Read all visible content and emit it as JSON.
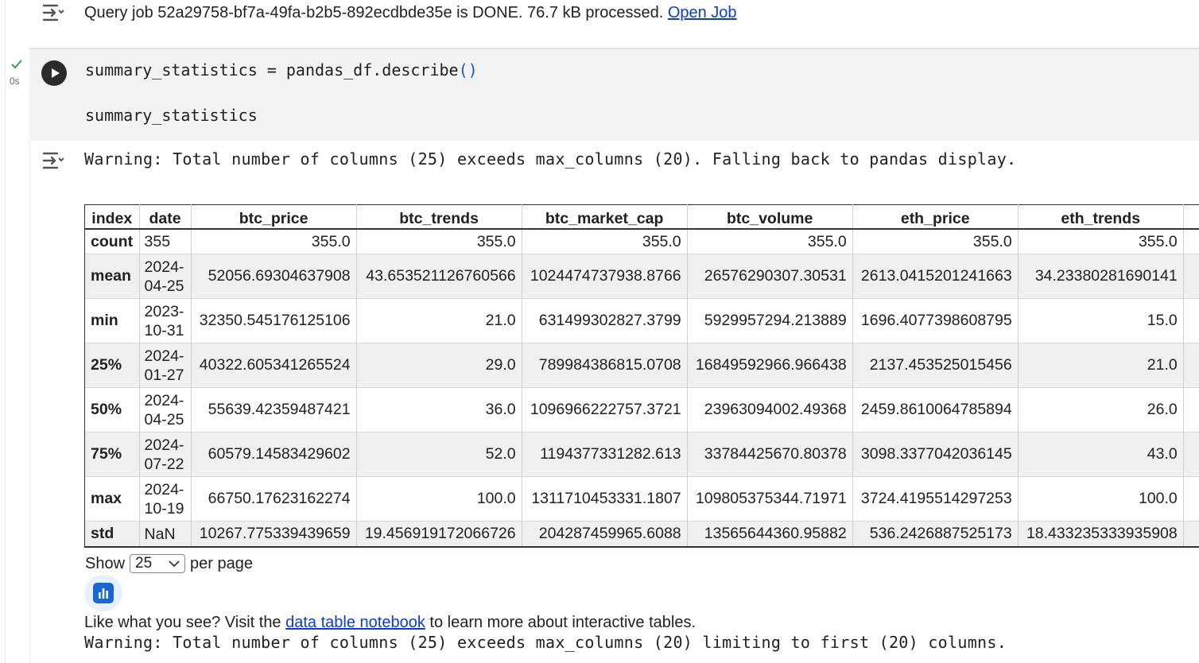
{
  "top_output": {
    "prefix": "Query job 52a29758-bf7a-49fa-b2b5-892ecdbde35e is DONE. 76.7 kB processed.",
    "link": "Open Job"
  },
  "cell": {
    "status": "check",
    "exec_time": "0s",
    "code_line1_main": "summary_statistics = pandas_df.describe",
    "code_line1_parens": "()",
    "code_line2": "summary_statistics"
  },
  "output": {
    "warning1": "Warning: Total number of columns (25) exceeds max_columns (20). Falling back to pandas display.",
    "warning2": "Warning: Total number of columns (25) exceeds max_columns (20) limiting to first (20) columns."
  },
  "table": {
    "columns": [
      "index",
      "date",
      "btc_price",
      "btc_trends",
      "btc_market_cap",
      "btc_volume",
      "eth_price",
      "eth_trends"
    ],
    "rows": [
      {
        "label": "count",
        "date_a": "355",
        "date_b": "",
        "values": [
          "355.0",
          "355.0",
          "355.0",
          "355.0",
          "355.0",
          "355.0"
        ]
      },
      {
        "label": "mean",
        "date_a": "2024-",
        "date_b": "04-25",
        "values": [
          "52056.69304637908",
          "43.653521126760566",
          "1024474737938.8766",
          "26576290307.30531",
          "2613.0415201241663",
          "34.23380281690141"
        ]
      },
      {
        "label": "min",
        "date_a": "2023-",
        "date_b": "10-31",
        "values": [
          "32350.545176125106",
          "21.0",
          "631499302827.3799",
          "5929957294.213889",
          "1696.4077398608795",
          "15.0"
        ]
      },
      {
        "label": "25%",
        "date_a": "2024-",
        "date_b": "01-27",
        "values": [
          "40322.605341265524",
          "29.0",
          "789984386815.0708",
          "16849592966.966438",
          "2137.453525015456",
          "21.0"
        ]
      },
      {
        "label": "50%",
        "date_a": "2024-",
        "date_b": "04-25",
        "values": [
          "55639.42359487421",
          "36.0",
          "1096966222757.3721",
          "23963094002.49368",
          "2459.8610064785894",
          "26.0"
        ]
      },
      {
        "label": "75%",
        "date_a": "2024-",
        "date_b": "07-22",
        "values": [
          "60579.14583429602",
          "52.0",
          "1194377331282.613",
          "33784425670.80378",
          "3098.3377042036145",
          "43.0"
        ]
      },
      {
        "label": "max",
        "date_a": "2024-",
        "date_b": "10-19",
        "values": [
          "66750.17623162274",
          "100.0",
          "1311710453331.1807",
          "109805375344.71971",
          "3724.4195514297253",
          "100.0"
        ]
      },
      {
        "label": "std",
        "date_a": "NaN",
        "date_b": "",
        "values": [
          "10267.775339439659",
          "19.456919172066726",
          "204287459965.6088",
          "13565644360.95882",
          "536.2426887525173",
          "18.433235333935908"
        ]
      }
    ]
  },
  "pager": {
    "show_label": "Show",
    "per_page_value": "25",
    "per_page_label": "per page"
  },
  "footer": {
    "like_prefix": "Like what you see? Visit the",
    "like_link": "data table notebook",
    "like_suffix": "to learn more about interactive tables."
  }
}
